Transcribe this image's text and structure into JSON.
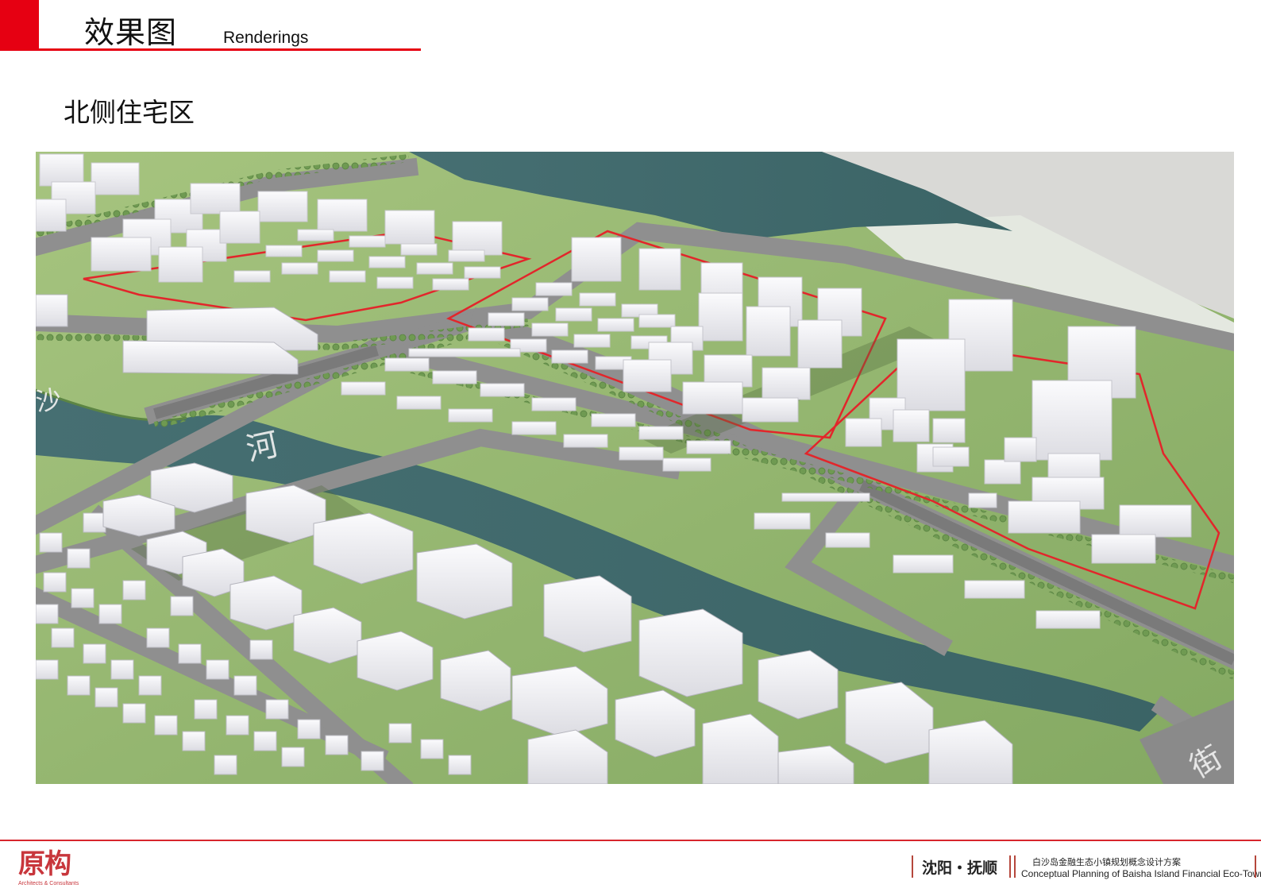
{
  "header": {
    "title": "效果图",
    "subtitle": "Renderings"
  },
  "section_title": "北侧住宅区",
  "rendering": {
    "description_labels": {
      "river_char_1": "河",
      "river_char_2": "沙",
      "road_char": "街"
    }
  },
  "footer": {
    "logo_mark": "原构",
    "logo_subtitle": "Architects & Consultants",
    "cities": "沈阳・抚顺",
    "project_cn": "白沙岛金融生态小镇规划概念设计方案",
    "project_en": "Conceptual Planning of Baisha Island Financial Eco-Town"
  },
  "colors": {
    "accent_red": "#e60012",
    "water": "#3f6a6c",
    "grass": "#93b870",
    "road": "#8c8c8c",
    "building": "#f1f1f4"
  }
}
